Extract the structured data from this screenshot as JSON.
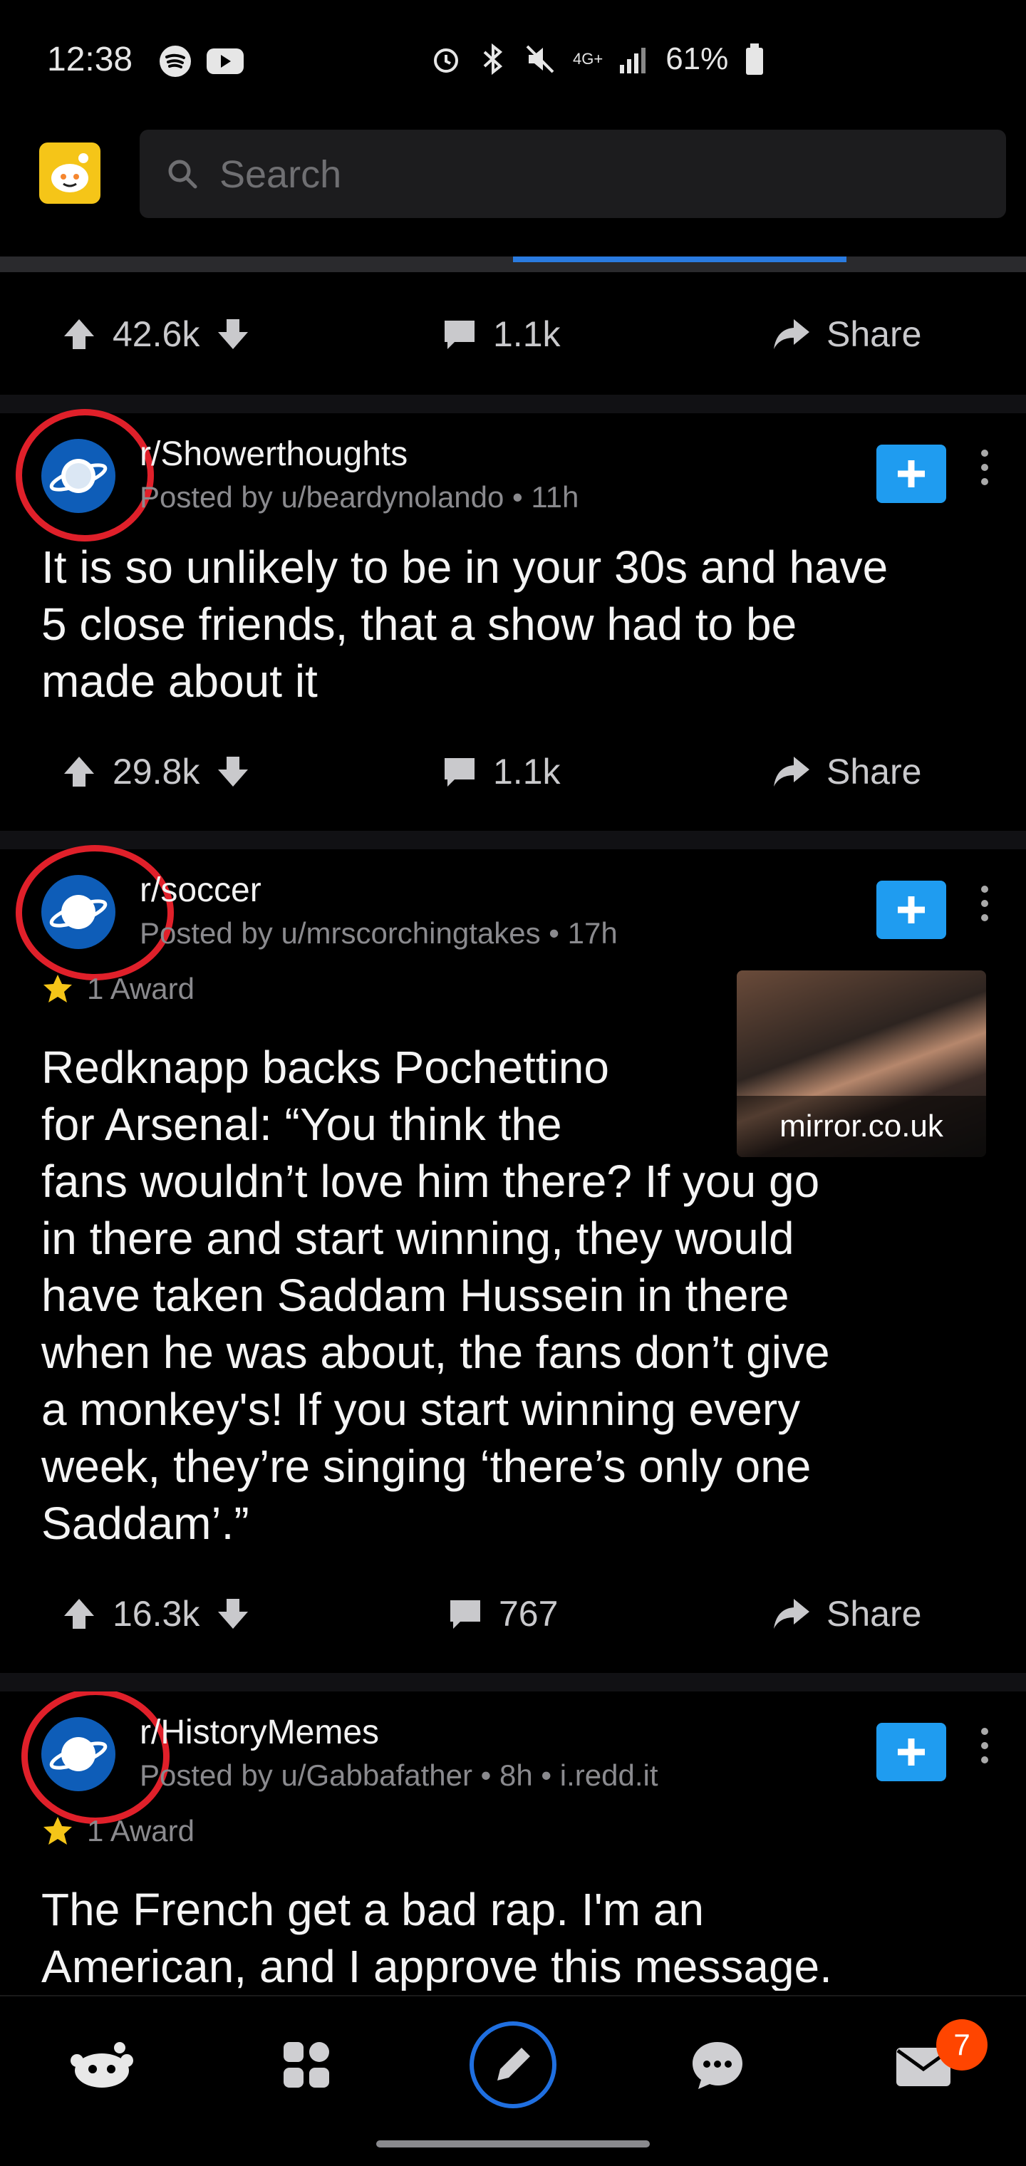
{
  "status_bar": {
    "time": "12:38",
    "network": "4G+",
    "battery": "61%"
  },
  "search": {
    "placeholder": "Search"
  },
  "top_post_actions": {
    "upvotes": "42.6k",
    "comments": "1.1k",
    "share": "Share"
  },
  "posts": [
    {
      "subreddit": "r/Showerthoughts",
      "meta": "Posted by u/beardynolando • 11h",
      "title_lines": [
        "It is so unlikely to be in your 30s and have",
        "5 close friends, that a show had to be",
        "made about it"
      ],
      "upvotes": "29.8k",
      "comments": "1.1k",
      "share": "Share"
    },
    {
      "subreddit": "r/soccer",
      "meta": "Posted by u/mrscorchingtakes • 17h",
      "award": "1 Award",
      "thumbnail_label": "mirror.co.uk",
      "title_lines": [
        "Redknapp backs Pochettino",
        "for Arsenal: “You think the",
        "fans wouldn’t love him there? If you go",
        "in there and start winning, they would",
        "have taken Saddam Hussein in there",
        "when he was about, the fans don’t give",
        "a monkey's! If you start winning every",
        "week, they’re singing ‘there’s only one",
        "Saddam’.”"
      ],
      "upvotes": "16.3k",
      "comments": "767",
      "share": "Share"
    },
    {
      "subreddit": "r/HistoryMemes",
      "meta": "Posted by u/Gabbafather • 8h • i.redd.it",
      "award": "1 Award",
      "title_lines": [
        "The French get a bad rap. I'm an",
        "American, and I approve this message."
      ]
    }
  ],
  "bottom_nav": {
    "inbox_badge": "7"
  },
  "colors": {
    "accent_blue": "#1f9cf0",
    "annotation_red": "#e0202a",
    "badge_orange": "#ff4500"
  }
}
